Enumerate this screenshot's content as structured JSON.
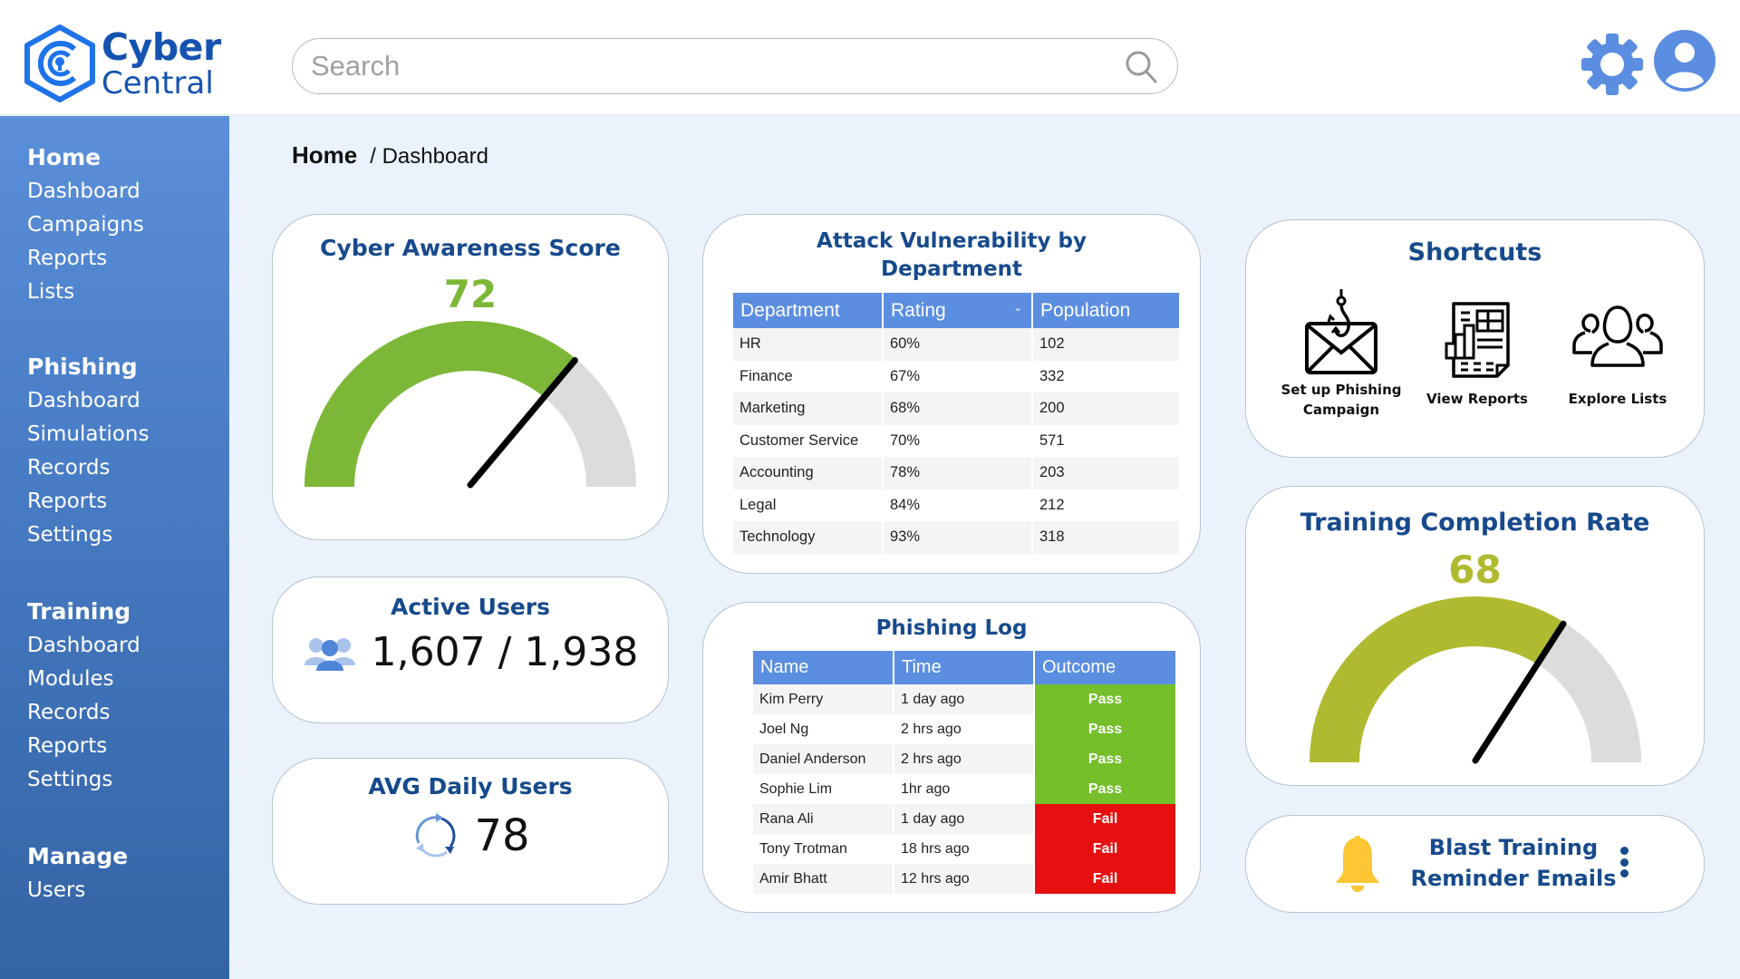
{
  "app": {
    "name_line1": "Cyber",
    "name_line2": "Central",
    "brand_color": "#1553b0"
  },
  "header": {
    "search_placeholder": "Search",
    "search_value": "",
    "icons": [
      "search-icon",
      "gear-icon",
      "user-avatar-icon"
    ]
  },
  "sidebar": {
    "groups": [
      {
        "heading": "Home",
        "items": [
          "Dashboard",
          "Campaigns",
          "Reports",
          "Lists"
        ]
      },
      {
        "heading": "Phishing",
        "items": [
          "Dashboard",
          "Simulations",
          "Records",
          "Reports",
          "Settings"
        ]
      },
      {
        "heading": "Training",
        "items": [
          "Dashboard",
          "Modules",
          "Records",
          "Reports",
          "Settings"
        ]
      },
      {
        "heading": "Manage",
        "items": [
          "Users"
        ]
      }
    ]
  },
  "breadcrumb": {
    "home": "Home",
    "current": "/ Dashboard"
  },
  "awareness": {
    "title": "Cyber Awareness Score",
    "value": "72",
    "gauge_fraction": 0.72,
    "color": "#7db737"
  },
  "active_users": {
    "title": "Active Users",
    "value": "1,607 / 1,938",
    "icon": "users-group-icon"
  },
  "avg_daily": {
    "title": "AVG Daily Users",
    "value": "78",
    "icon": "refresh-cycle-icon"
  },
  "attack": {
    "title_line1": "Attack Vulnerability by",
    "title_line2": "Department",
    "columns": [
      "Department",
      "Rating",
      "Population"
    ],
    "sort_indicator": "⌄",
    "rows": [
      [
        "HR",
        "60%",
        "102"
      ],
      [
        "Finance",
        "67%",
        "332"
      ],
      [
        "Marketing",
        "68%",
        "200"
      ],
      [
        "Customer Service",
        "70%",
        "571"
      ],
      [
        "Accounting",
        "78%",
        "203"
      ],
      [
        "Legal",
        "84%",
        "212"
      ],
      [
        "Technology",
        "93%",
        "318"
      ]
    ]
  },
  "phishing_log": {
    "title": "Phishing Log",
    "columns": [
      "Name",
      "Time",
      "Outcome"
    ],
    "rows": [
      [
        "Kim Perry",
        "1 day ago",
        "Pass"
      ],
      [
        "Joel Ng",
        "2 hrs ago",
        "Pass"
      ],
      [
        "Daniel Anderson",
        "2 hrs ago",
        "Pass"
      ],
      [
        "Sophie Lim",
        "1hr ago",
        "Pass"
      ],
      [
        "Rana Ali",
        "1 day ago",
        "Fail"
      ],
      [
        "Tony Trotman",
        "18 hrs ago",
        "Fail"
      ],
      [
        "Amir Bhatt",
        "12 hrs ago",
        "Fail"
      ]
    ],
    "pass_color": "#74bf2a",
    "fail_color": "#e61010"
  },
  "shortcuts": {
    "title": "Shortcuts",
    "items": [
      {
        "label_line1": "Set up Phishing",
        "label_line2": "Campaign",
        "icon": "phishing-envelope-icon"
      },
      {
        "label_line1": "View Reports",
        "label_line2": "",
        "icon": "report-document-icon"
      },
      {
        "label_line1": "Explore Lists",
        "label_line2": "",
        "icon": "people-group-icon"
      }
    ]
  },
  "training": {
    "title": "Training Completion Rate",
    "value": "68",
    "gauge_fraction": 0.68,
    "color": "#b0ba30"
  },
  "blast": {
    "line1": "Blast Training",
    "line2": "Reminder Emails",
    "icon": "bell-icon",
    "menu_icon": "kebab-menu-icon"
  }
}
